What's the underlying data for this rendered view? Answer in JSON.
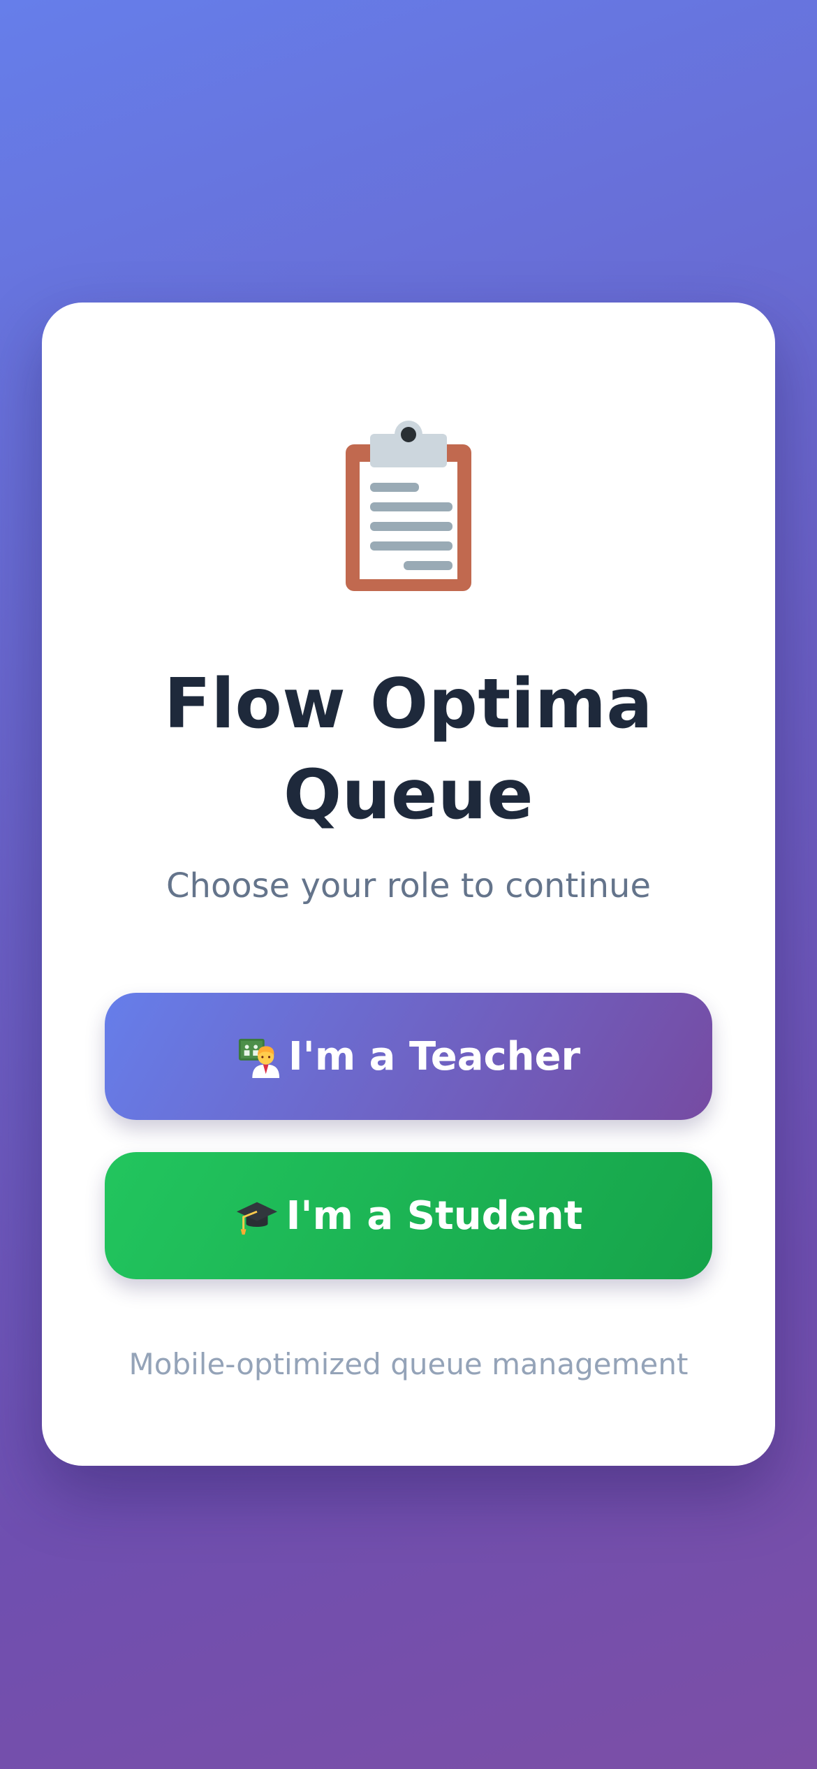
{
  "app": {
    "logo_icon": "clipboard-icon",
    "title": "Flow Optima Queue",
    "subtitle": "Choose your role to continue"
  },
  "roles": {
    "teacher": {
      "icon": "teacher-icon",
      "label": "I'm a Teacher",
      "gradient": [
        "#667eea",
        "#764ba2"
      ]
    },
    "student": {
      "icon": "graduation-cap-icon",
      "label": "I'm a Student",
      "gradient": [
        "#22c55e",
        "#16a34a"
      ]
    }
  },
  "footer": {
    "note": "Mobile-optimized queue management"
  },
  "colors": {
    "background_start": "#667eea",
    "background_end": "#764ba2",
    "card": "#ffffff",
    "title": "#1e293b",
    "subtitle": "#64748b",
    "footer": "#94a3b8"
  }
}
